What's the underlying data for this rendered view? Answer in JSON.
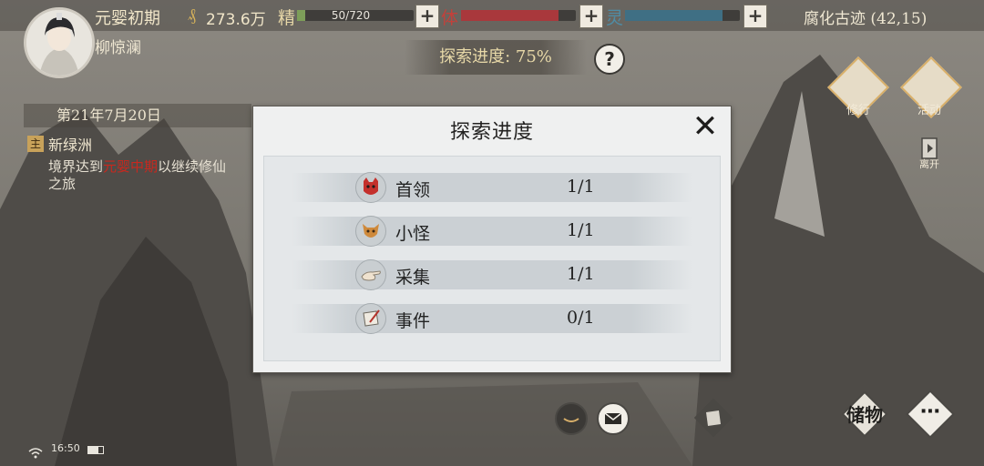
{
  "player": {
    "realm": "元婴初期",
    "money": "273.6万",
    "name": "柳惊澜"
  },
  "stats": {
    "jing_label": "精",
    "jing_value": "50/720",
    "jing_fraction": 0.07,
    "ti_label": "体",
    "ti_fraction": 0.85,
    "ling_label": "灵",
    "ling_fraction": 0.85,
    "plus": "+"
  },
  "location": "腐化古迹 (42,15)",
  "exploration": {
    "progress_text": "探索进度: 75%",
    "help": "?"
  },
  "actions": [
    {
      "label": "修行"
    },
    {
      "label": "活动"
    },
    {
      "label": "离开"
    }
  ],
  "quest": {
    "date": "第21年7月20日",
    "tag": "主",
    "title": "新绿洲",
    "desc_pre": "境界达到",
    "desc_highlight": "元婴中期",
    "desc_post": "以继续修仙之旅"
  },
  "status_bar": {
    "time": "16:50"
  },
  "bottom_buttons": {
    "storage_label": "储物",
    "more_label": "⋯"
  },
  "dialog": {
    "title": "探索进度",
    "close": "✕",
    "rows": [
      {
        "label": "首领",
        "value": "1/1",
        "icon": "demon-mask-icon"
      },
      {
        "label": "小怪",
        "value": "1/1",
        "icon": "fox-mask-icon"
      },
      {
        "label": "采集",
        "value": "1/1",
        "icon": "hand-gather-icon"
      },
      {
        "label": "事件",
        "value": "0/1",
        "icon": "scroll-quill-icon"
      }
    ]
  },
  "colors": {
    "ti_bar": "#a9383c",
    "ling_bar": "#3f6f84",
    "highlight": "#c8281e"
  }
}
